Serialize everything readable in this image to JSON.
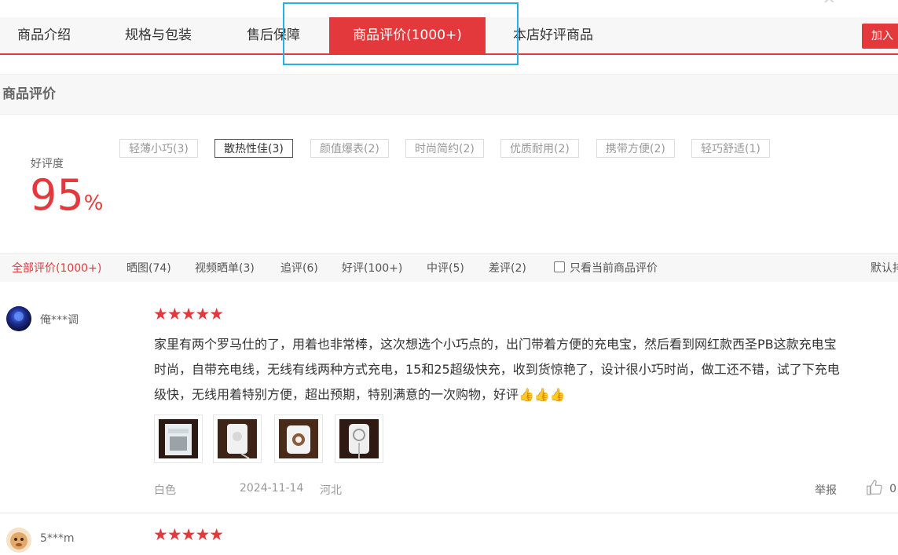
{
  "nav": {
    "tabs": [
      "商品介绍",
      "规格与包装",
      "售后保障",
      "商品评价(1000+)",
      "本店好评商品"
    ],
    "active_index": 3,
    "add_cart_label": "加入"
  },
  "section": {
    "title": "商品评价"
  },
  "rating": {
    "label": "好评度",
    "value": "95",
    "unit": "%"
  },
  "tags": [
    "轻薄小巧(3)",
    "散热性佳(3)",
    "颜值爆表(2)",
    "时尚简约(2)",
    "优质耐用(2)",
    "携带方便(2)",
    "轻巧舒适(1)"
  ],
  "selected_tag_index": 1,
  "filters": {
    "items": [
      "全部评价(1000+)",
      "晒图(74)",
      "视频晒单(3)",
      "追评(6)",
      "好评(100+)",
      "中评(5)",
      "差评(2)"
    ],
    "only_current_label": "只看当前商品评价",
    "sort_label": "默认排"
  },
  "reviews": [
    {
      "user": "俺***调",
      "stars": 5,
      "lines": [
        "家里有两个罗马仕的了，用着也非常棒，这次想选个小巧点的，出门带着方便的充电宝，然后看到网红款西圣PB这款充电宝",
        "时尚，自带充电线，无线有线两种方式充电，15和25超级快充，收到货惊艳了，设计很小巧时尚，做工还不错，试了下充电",
        "级快，无线用着特别方便，超出预期，特别满意的一次购物，好评👍👍👍"
      ],
      "color": "白色",
      "date": "2024-11-14",
      "location": "河北",
      "report_label": "举报",
      "likes": "0"
    },
    {
      "user": "5***m",
      "stars": 5
    }
  ],
  "colors": {
    "accent": "#e4393c",
    "highlight": "#26b0e6"
  }
}
